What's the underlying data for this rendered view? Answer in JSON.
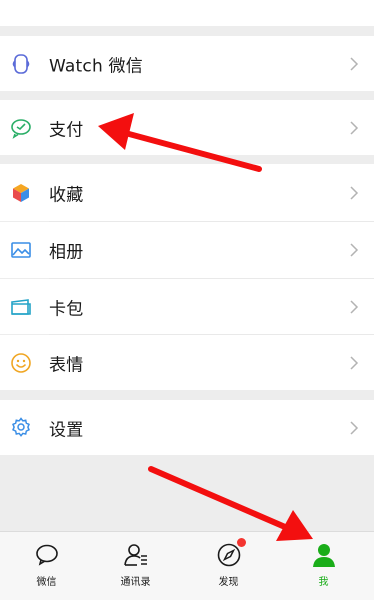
{
  "menu": {
    "watch_label": "Watch 微信",
    "pay_label": "支付",
    "favorites_label": "收藏",
    "album_label": "相册",
    "cards_label": "卡包",
    "stickers_label": "表情",
    "settings_label": "设置"
  },
  "tabbar": {
    "chats_label": "微信",
    "contacts_label": "通讯录",
    "discover_label": "发现",
    "me_label": "我"
  },
  "colors": {
    "accent": "#1aad19",
    "annotation": "#f30f0f",
    "badge": "#f43530"
  }
}
